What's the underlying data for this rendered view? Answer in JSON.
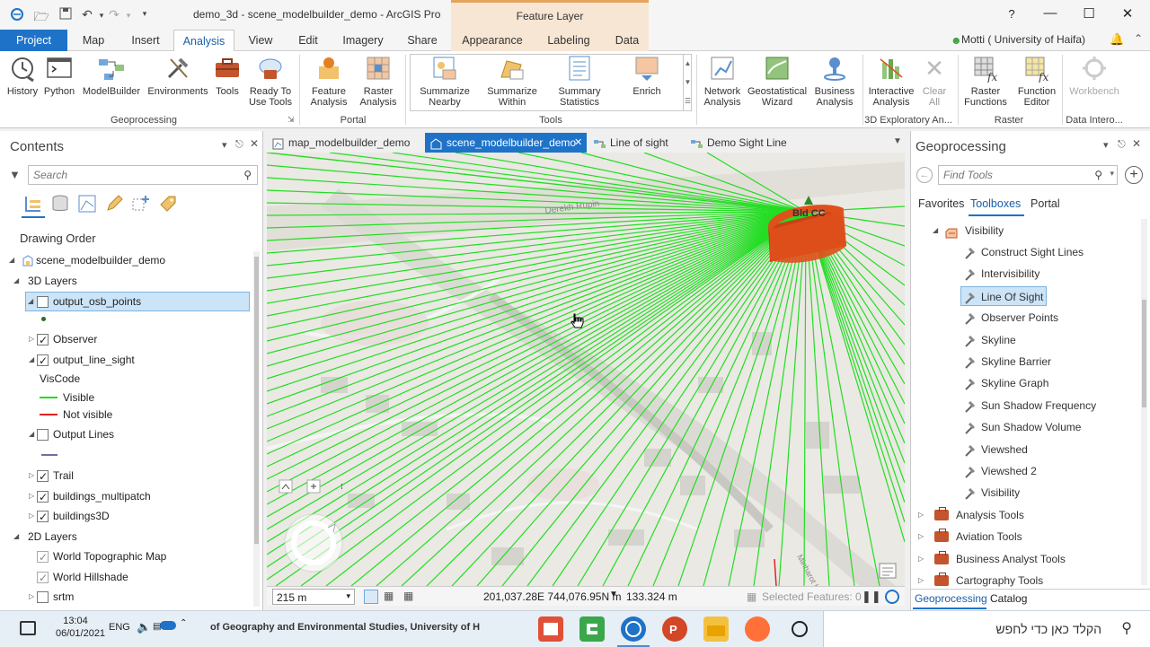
{
  "titlebar": {
    "title": "demo_3d - scene_modelbuilder_demo - ArcGIS Pro",
    "context_tab_group": "Feature Layer",
    "help": "?"
  },
  "ribbon_tabs": [
    "Project",
    "Map",
    "Insert",
    "Analysis",
    "View",
    "Edit",
    "Imagery",
    "Share",
    "Appearance",
    "Labeling",
    "Data"
  ],
  "active_tab": "Analysis",
  "user": "Motti ( University of Haifa)",
  "ribbon": {
    "geoprocessing": {
      "label": "Geoprocessing",
      "buttons": [
        "History",
        "Python",
        "ModelBuilder",
        "Environments",
        "Tools",
        "Ready To Use Tools"
      ]
    },
    "portal": {
      "label": "Portal",
      "buttons": [
        "Feature Analysis",
        "Raster Analysis"
      ]
    },
    "tools": {
      "label": "Tools",
      "buttons": [
        "Summarize Nearby",
        "Summarize Within",
        "Summary Statistics",
        "Enrich"
      ]
    },
    "more": {
      "buttons": [
        "Network Analysis",
        "Geostatistical Wizard",
        "Business Analysis"
      ]
    },
    "exploratory": {
      "label": "3D Exploratory An...",
      "buttons": [
        "Interactive Analysis",
        "Clear All"
      ]
    },
    "raster": {
      "label": "Raster",
      "buttons": [
        "Raster Functions",
        "Function Editor"
      ]
    },
    "data_interop": {
      "label": "Data Intero...",
      "buttons": [
        "Workbench"
      ]
    }
  },
  "contents": {
    "title": "Contents",
    "search_placeholder": "Search",
    "drawing_order": "Drawing Order",
    "rows": [
      {
        "label": "scene_modelbuilder_demo"
      },
      {
        "label": "3D Layers"
      },
      {
        "label": "output_osb_points"
      },
      {
        "label": "Observer"
      },
      {
        "label": "output_line_sight"
      },
      {
        "label": "VisCode"
      },
      {
        "label": "Visible"
      },
      {
        "label": "Not visible"
      },
      {
        "label": "Output Lines"
      },
      {
        "label": "Trail"
      },
      {
        "label": "buildings_multipatch"
      },
      {
        "label": "buildings3D"
      },
      {
        "label": "2D Layers"
      },
      {
        "label": "World Topographic Map"
      },
      {
        "label": "World Hillshade"
      },
      {
        "label": "srtm"
      }
    ]
  },
  "view_tabs": [
    "map_modelbuilder_demo",
    "scene_modelbuilder_demo",
    "Line of sight",
    "Demo Sight Line"
  ],
  "active_view": "scene_modelbuilder_demo",
  "scene": {
    "building_label": "Bld CC",
    "street_labels": [
      "Derekh Rupin",
      "Minharot Hako"
    ],
    "line_color": "#22dd22",
    "building_color": "#e0501c"
  },
  "statusbar": {
    "scale": "215 m",
    "coords": "201,037.28E 744,076.95N m",
    "elevation": "133.324 m",
    "selected": "Selected Features: 0"
  },
  "geoprocessing": {
    "title": "Geoprocessing",
    "search_placeholder": "Find Tools",
    "tabs": [
      "Favorites",
      "Toolboxes",
      "Portal"
    ],
    "active_tab": "Toolboxes",
    "toolset": "Visibility",
    "tools": [
      "Construct Sight Lines",
      "Intervisibility",
      "Line Of Sight",
      "Observer Points",
      "Skyline",
      "Skyline Barrier",
      "Skyline Graph",
      "Sun Shadow Frequency",
      "Sun Shadow Volume",
      "Viewshed",
      "Viewshed 2",
      "Visibility"
    ],
    "selected_tool": "Line Of Sight",
    "toolboxes": [
      "Analysis Tools",
      "Aviation Tools",
      "Business Analyst Tools",
      "Cartography Tools"
    ],
    "bottom_tabs": [
      "Geoprocessing",
      "Catalog"
    ]
  },
  "taskbar": {
    "time": "13:04",
    "date": "06/01/2021",
    "lang": "ENG",
    "overlay_text": "of Geography and Environmental Studies, University of Haifa",
    "search_text": "הקלד כאן כדי לחפש"
  }
}
